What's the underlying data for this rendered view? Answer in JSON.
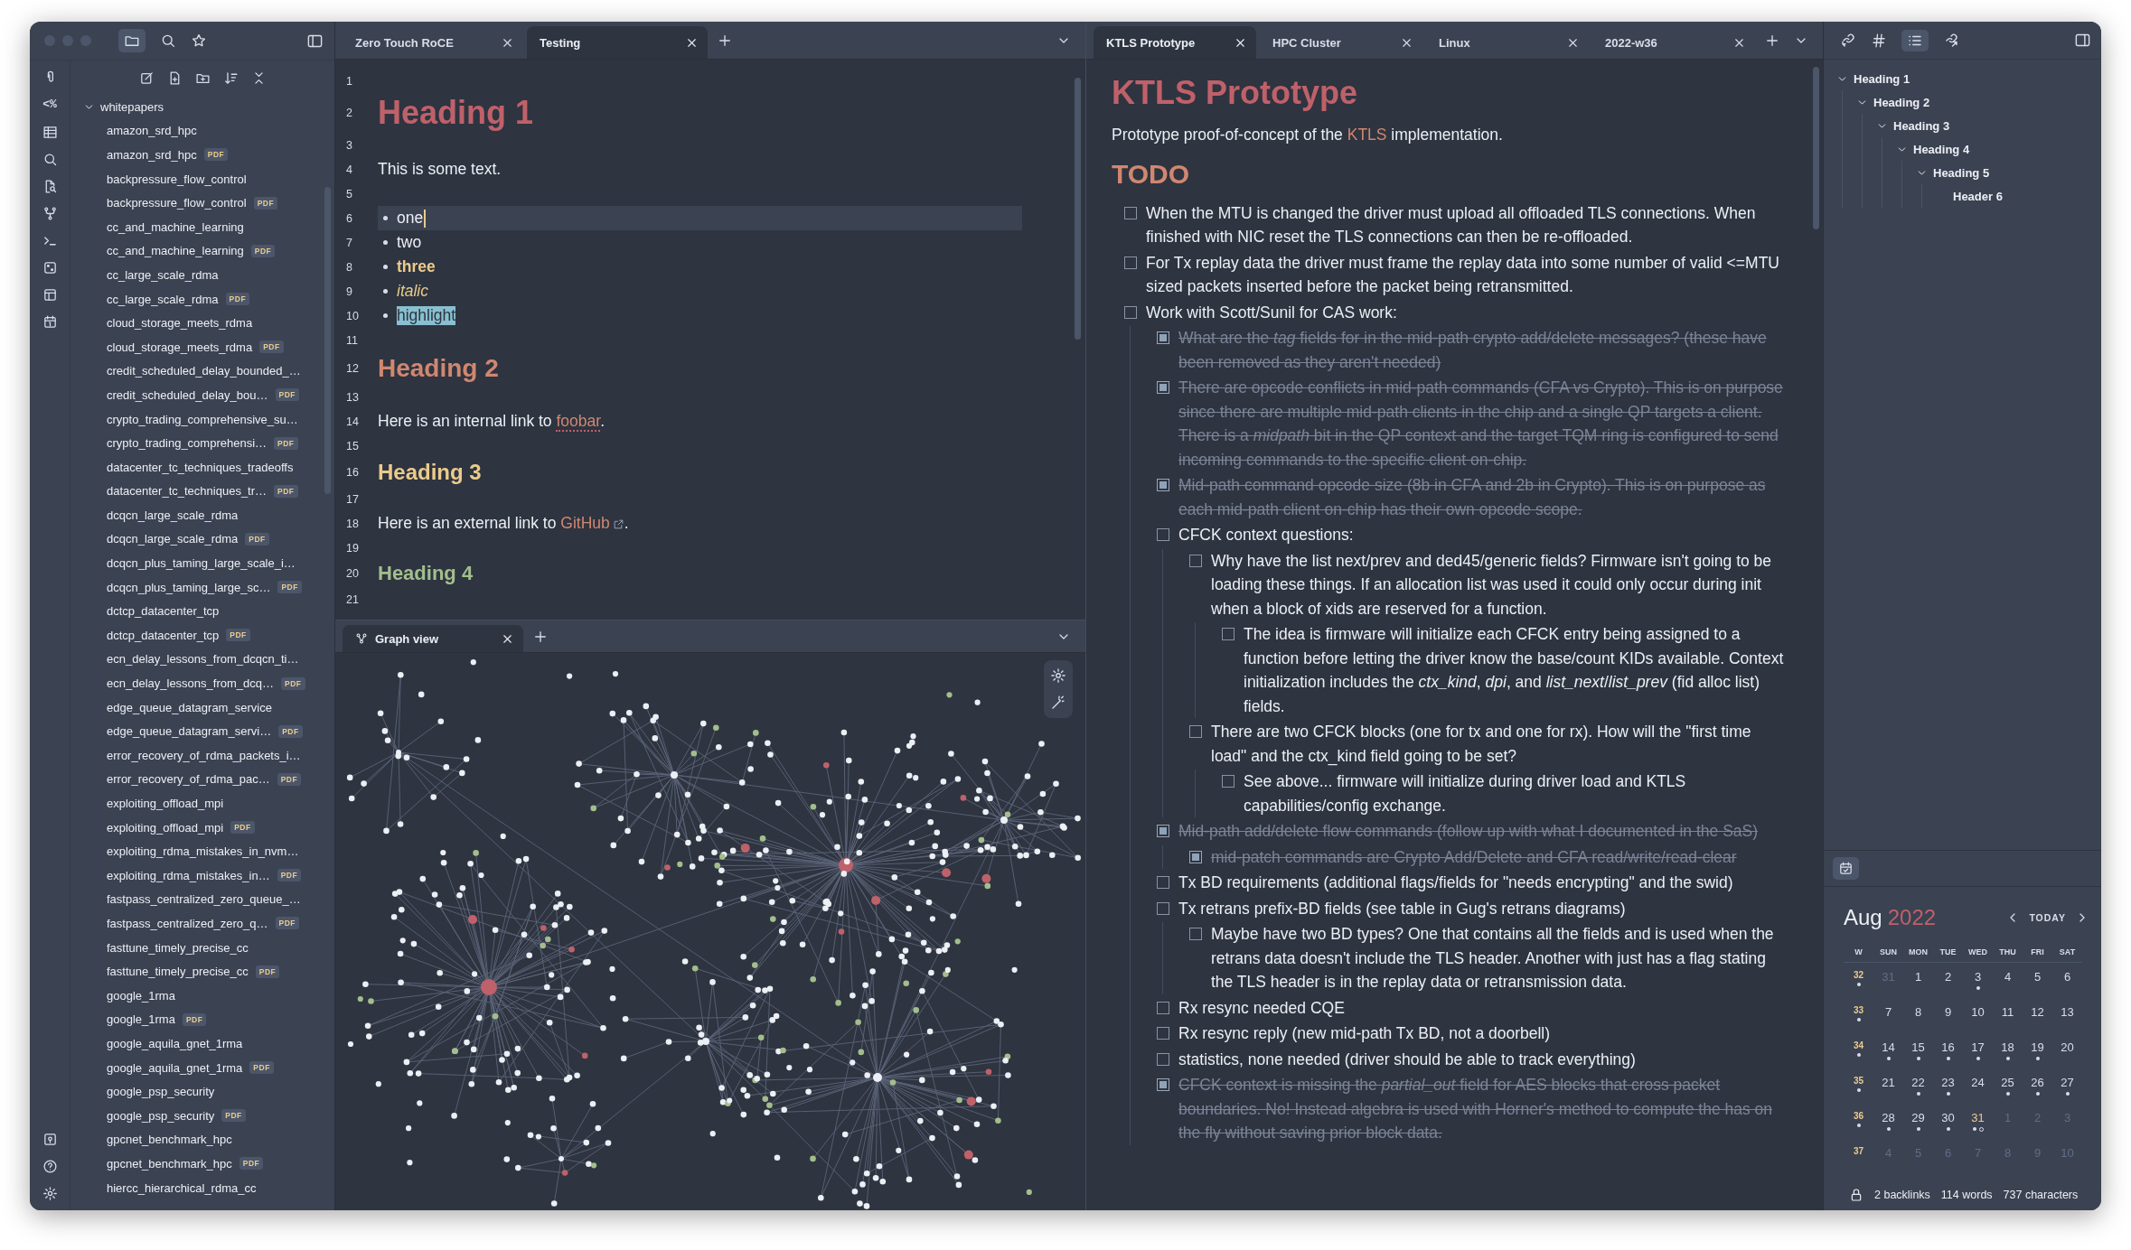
{
  "ribbon": {
    "template_glyph": "<%"
  },
  "explorer": {
    "folder": {
      "name": "whitepapers",
      "expanded": true,
      "children": [
        {
          "name": "amazon_srd_hpc"
        },
        {
          "name": "amazon_srd_hpc",
          "badge": "PDF"
        },
        {
          "name": "backpressure_flow_control"
        },
        {
          "name": "backpressure_flow_control",
          "badge": "PDF"
        },
        {
          "name": "cc_and_machine_learning"
        },
        {
          "name": "cc_and_machine_learning",
          "badge": "PDF"
        },
        {
          "name": "cc_large_scale_rdma"
        },
        {
          "name": "cc_large_scale_rdma",
          "badge": "PDF"
        },
        {
          "name": "cloud_storage_meets_rdma"
        },
        {
          "name": "cloud_storage_meets_rdma",
          "badge": "PDF"
        },
        {
          "name": "credit_scheduled_delay_bounded_…"
        },
        {
          "name": "credit_scheduled_delay_bou…",
          "badge": "PDF"
        },
        {
          "name": "crypto_trading_comprehensive_su…"
        },
        {
          "name": "crypto_trading_comprehensi…",
          "badge": "PDF"
        },
        {
          "name": "datacenter_tc_techniques_tradeoffs"
        },
        {
          "name": "datacenter_tc_techniques_tr…",
          "badge": "PDF"
        },
        {
          "name": "dcqcn_large_scale_rdma"
        },
        {
          "name": "dcqcn_large_scale_rdma",
          "badge": "PDF"
        },
        {
          "name": "dcqcn_plus_taming_large_scale_i…"
        },
        {
          "name": "dcqcn_plus_taming_large_sc…",
          "badge": "PDF"
        },
        {
          "name": "dctcp_datacenter_tcp"
        },
        {
          "name": "dctcp_datacenter_tcp",
          "badge": "PDF"
        },
        {
          "name": "ecn_delay_lessons_from_dcqcn_ti…"
        },
        {
          "name": "ecn_delay_lessons_from_dcq…",
          "badge": "PDF"
        },
        {
          "name": "edge_queue_datagram_service"
        },
        {
          "name": "edge_queue_datagram_servi…",
          "badge": "PDF"
        },
        {
          "name": "error_recovery_of_rdma_packets_i…"
        },
        {
          "name": "error_recovery_of_rdma_pac…",
          "badge": "PDF"
        },
        {
          "name": "exploiting_offload_mpi"
        },
        {
          "name": "exploiting_offload_mpi",
          "badge": "PDF"
        },
        {
          "name": "exploiting_rdma_mistakes_in_nvm…"
        },
        {
          "name": "exploiting_rdma_mistakes_in…",
          "badge": "PDF"
        },
        {
          "name": "fastpass_centralized_zero_queue_…"
        },
        {
          "name": "fastpass_centralized_zero_q…",
          "badge": "PDF"
        },
        {
          "name": "fasttune_timely_precise_cc"
        },
        {
          "name": "fasttune_timely_precise_cc",
          "badge": "PDF"
        },
        {
          "name": "google_1rma"
        },
        {
          "name": "google_1rma",
          "badge": "PDF"
        },
        {
          "name": "google_aquila_gnet_1rma"
        },
        {
          "name": "google_aquila_gnet_1rma",
          "badge": "PDF"
        },
        {
          "name": "google_psp_security"
        },
        {
          "name": "google_psp_security",
          "badge": "PDF"
        },
        {
          "name": "gpcnet_benchmark_hpc"
        },
        {
          "name": "gpcnet_benchmark_hpc",
          "badge": "PDF"
        },
        {
          "name": "hiercc_hierarchical_rdma_cc"
        }
      ]
    }
  },
  "left_pane": {
    "tabs": [
      {
        "label": "Zero Touch RoCE",
        "selected": false
      },
      {
        "label": "Testing",
        "selected": true
      }
    ],
    "lines": [
      {
        "number": "1",
        "kind": "blank",
        "active": false
      },
      {
        "number": "2",
        "kind": "h1",
        "text": "Heading 1",
        "active": false
      },
      {
        "number": "3",
        "kind": "blank",
        "active": false
      },
      {
        "number": "4",
        "kind": "text",
        "text": "This is some text.",
        "active": false
      },
      {
        "number": "5",
        "kind": "blank",
        "active": false
      },
      {
        "number": "6",
        "kind": "bullet",
        "text": "one",
        "active": true
      },
      {
        "number": "7",
        "kind": "bullet",
        "text": "two",
        "active": false
      },
      {
        "number": "8",
        "kind": "bold_bullet",
        "text": "three",
        "active": false
      },
      {
        "number": "9",
        "kind": "italic_bullet",
        "text": "italic",
        "active": false
      },
      {
        "number": "10",
        "kind": "highlight_bullet",
        "text": "highlight",
        "active": false
      },
      {
        "number": "11",
        "kind": "blank",
        "active": false
      },
      {
        "number": "12",
        "kind": "h2",
        "text": "Heading 2",
        "active": false
      },
      {
        "number": "13",
        "kind": "blank",
        "active": false
      },
      {
        "number": "14",
        "kind": "internal_link_text",
        "text": "Here is an internal link to ",
        "link": "foobar",
        "after": ".",
        "active": false
      },
      {
        "number": "15",
        "kind": "blank",
        "active": false
      },
      {
        "number": "16",
        "kind": "h3",
        "text": "Heading 3",
        "active": false
      },
      {
        "number": "17",
        "kind": "blank",
        "active": false
      },
      {
        "number": "18",
        "kind": "external_link_text",
        "text": "Here is an external link to ",
        "link": "GitHub",
        "after": ".",
        "active": false
      },
      {
        "number": "19",
        "kind": "blank",
        "active": false
      },
      {
        "number": "20",
        "kind": "h4",
        "text": "Heading 4",
        "active": false
      },
      {
        "number": "21",
        "kind": "blank",
        "active": false
      }
    ]
  },
  "graph_pane": {
    "tabs": [
      {
        "label": "Graph view",
        "selected": true
      }
    ]
  },
  "right_pane": {
    "tabs": [
      {
        "label": "KTLS Prototype",
        "selected": true
      },
      {
        "label": "HPC Cluster",
        "selected": false
      },
      {
        "label": "Linux",
        "selected": false
      },
      {
        "label": "2022-w36",
        "selected": false
      }
    ],
    "title": "KTLS Prototype",
    "intro": {
      "before": "Prototype proof-of-concept of the ",
      "link": "KTLS",
      "after": " implementation."
    },
    "heading": "TODO",
    "tasks": [
      {
        "text": "When the MTU is changed the driver must upload all offloaded TLS connections. When finished with NIC reset the TLS connections can then be re-offloaded.",
        "checked": false
      },
      {
        "text": "For Tx replay data the driver must frame the replay data into some number of valid <=MTU sized packets inserted before the packet being retransmitted.",
        "checked": false
      },
      {
        "text": "Work with Scott/Sunil for CAS work:",
        "checked": false,
        "children": [
          {
            "text": "What are the *tag* fields for in the mid-path crypto add/delete messages? (these have been removed as they aren't needed)",
            "checked": true
          },
          {
            "text": "There are opcode conflicts in mid-path commands (CFA vs Crypto). This is on purpose since there are multiple mid-path clients in the chip and a single QP targets a client. There is a *midpath* bit in the QP context and the target TQM ring is configured to send incoming commands to the specific client on-chip.",
            "checked": true
          },
          {
            "text": "Mid-path command opcode size (8b in CFA and 2b in Crypto). This is on purpose as each mid-path client on-chip has their own opcode scope.",
            "checked": true
          },
          {
            "text": "CFCK context questions:",
            "checked": false,
            "children": [
              {
                "text": "Why have the list next/prev and ded45/generic fields? Firmware isn't going to be loading these things. If an allocation list was used it could only occur during init when a block of xids are reserved for a function.",
                "checked": false,
                "children": [
                  {
                    "text": "The idea is firmware will initialize each CFCK entry being assigned to a function before letting the driver know the base/count KIDs available. Context initialization includes the *ctx_kind*, *dpi*, and *list_next*/*list_prev* (fid alloc list) fields.",
                    "checked": false
                  }
                ]
              },
              {
                "text": "There are two CFCK blocks (one for tx and one for rx). How will the \"first time load\" and the ctx_kind field going to be set?",
                "checked": false,
                "children": [
                  {
                    "text": "See above... firmware will initialize during driver load and KTLS capabilities/config exchange.",
                    "checked": false
                  }
                ]
              }
            ]
          },
          {
            "text": "Mid-path add/delete flow commands (follow up with what I documented in the SaS)",
            "checked": true,
            "children": [
              {
                "text": "mid-patch commands are Crypto Add/Delete and CFA read/write/read-clear",
                "checked": true
              }
            ]
          },
          {
            "text": "Tx BD requirements (additional flags/fields for \"needs encrypting\" and the swid)",
            "checked": false
          },
          {
            "text": "Tx retrans prefix-BD fields (see table in Gug's retrans diagrams)",
            "checked": false,
            "children": [
              {
                "text": "Maybe have two BD types? One that contains all the fields and is used when the retrans data doesn't include the TLS header. Another with just has a flag stating the TLS header is in the replay data or retransmission data.",
                "checked": false
              }
            ]
          },
          {
            "text": "Rx resync needed CQE",
            "checked": false
          },
          {
            "text": "Rx resync reply (new mid-path Tx BD, not a doorbell)",
            "checked": false
          },
          {
            "text": "statistics, none needed (driver should be able to track everything)",
            "checked": false
          },
          {
            "text": "CFCK context is missing the *partial_out* field for AES blocks that cross packet boundaries. No! Instead algebra is used with Horner's method to compute the has on the fly without saving prior block data.",
            "checked": true
          }
        ]
      }
    ]
  },
  "outline": [
    {
      "label": "Heading 1",
      "expanded": true,
      "children": [
        {
          "label": "Heading 2",
          "expanded": true,
          "children": [
            {
              "label": "Heading 3",
              "expanded": true,
              "children": [
                {
                  "label": "Heading 4",
                  "expanded": true,
                  "children": [
                    {
                      "label": "Heading 5",
                      "expanded": true,
                      "children": [
                        {
                          "label": "Header 6"
                        }
                      ]
                    }
                  ]
                }
              ]
            }
          ]
        }
      ]
    }
  ],
  "calendar": {
    "month": "Aug",
    "year": "2022",
    "today_button": "TODAY",
    "weekdays": [
      "W",
      "SUN",
      "MON",
      "TUE",
      "WED",
      "THU",
      "FRI",
      "SAT"
    ],
    "weeks": [
      {
        "week": "32",
        "dot": true,
        "days": [
          {
            "day": "31",
            "outside": true,
            "today": false,
            "dot": false,
            "task_dot": false
          },
          {
            "day": "1",
            "outside": false,
            "today": false,
            "dot": false,
            "task_dot": false
          },
          {
            "day": "2",
            "outside": false,
            "today": false,
            "dot": false,
            "task_dot": false
          },
          {
            "day": "3",
            "outside": false,
            "today": false,
            "dot": true,
            "task_dot": false
          },
          {
            "day": "4",
            "outside": false,
            "today": false,
            "dot": false,
            "task_dot": false
          },
          {
            "day": "5",
            "outside": false,
            "today": false,
            "dot": false,
            "task_dot": false
          },
          {
            "day": "6",
            "outside": false,
            "today": false,
            "dot": false,
            "task_dot": false
          }
        ]
      },
      {
        "week": "33",
        "dot": true,
        "days": [
          {
            "day": "7",
            "outside": false,
            "today": false,
            "dot": false,
            "task_dot": false
          },
          {
            "day": "8",
            "outside": false,
            "today": false,
            "dot": false,
            "task_dot": false
          },
          {
            "day": "9",
            "outside": false,
            "today": false,
            "dot": false,
            "task_dot": false
          },
          {
            "day": "10",
            "outside": false,
            "today": false,
            "dot": false,
            "task_dot": false
          },
          {
            "day": "11",
            "outside": false,
            "today": false,
            "dot": false,
            "task_dot": false
          },
          {
            "day": "12",
            "outside": false,
            "today": false,
            "dot": false,
            "task_dot": false
          },
          {
            "day": "13",
            "outside": false,
            "today": false,
            "dot": false,
            "task_dot": false
          }
        ]
      },
      {
        "week": "34",
        "dot": true,
        "days": [
          {
            "day": "14",
            "outside": false,
            "today": false,
            "dot": true,
            "task_dot": false
          },
          {
            "day": "15",
            "outside": false,
            "today": false,
            "dot": true,
            "task_dot": false
          },
          {
            "day": "16",
            "outside": false,
            "today": false,
            "dot": true,
            "task_dot": false
          },
          {
            "day": "17",
            "outside": false,
            "today": false,
            "dot": true,
            "task_dot": false
          },
          {
            "day": "18",
            "outside": false,
            "today": false,
            "dot": true,
            "task_dot": false
          },
          {
            "day": "19",
            "outside": false,
            "today": false,
            "dot": true,
            "task_dot": false
          },
          {
            "day": "20",
            "outside": false,
            "today": false,
            "dot": false,
            "task_dot": false
          }
        ]
      },
      {
        "week": "35",
        "dot": true,
        "days": [
          {
            "day": "21",
            "outside": false,
            "today": false,
            "dot": false,
            "task_dot": false
          },
          {
            "day": "22",
            "outside": false,
            "today": false,
            "dot": true,
            "task_dot": false
          },
          {
            "day": "23",
            "outside": false,
            "today": false,
            "dot": true,
            "task_dot": false
          },
          {
            "day": "24",
            "outside": false,
            "today": false,
            "dot": false,
            "task_dot": false
          },
          {
            "day": "25",
            "outside": false,
            "today": false,
            "dot": true,
            "task_dot": false
          },
          {
            "day": "26",
            "outside": false,
            "today": false,
            "dot": true,
            "task_dot": false
          },
          {
            "day": "27",
            "outside": false,
            "today": false,
            "dot": true,
            "task_dot": false
          }
        ]
      },
      {
        "week": "36",
        "dot": true,
        "days": [
          {
            "day": "28",
            "outside": false,
            "today": false,
            "dot": true,
            "task_dot": false
          },
          {
            "day": "29",
            "outside": false,
            "today": false,
            "dot": true,
            "task_dot": false
          },
          {
            "day": "30",
            "outside": false,
            "today": false,
            "dot": true,
            "task_dot": false
          },
          {
            "day": "31",
            "outside": false,
            "today": true,
            "dot": true,
            "task_dot": true
          },
          {
            "day": "1",
            "outside": true,
            "today": false,
            "dot": false,
            "task_dot": false
          },
          {
            "day": "2",
            "outside": true,
            "today": false,
            "dot": false,
            "task_dot": false
          },
          {
            "day": "3",
            "outside": true,
            "today": false,
            "dot": false,
            "task_dot": false
          }
        ]
      },
      {
        "week": "37",
        "dot": false,
        "days": [
          {
            "day": "4",
            "outside": true,
            "today": false,
            "dot": false,
            "task_dot": false
          },
          {
            "day": "5",
            "outside": true,
            "today": false,
            "dot": false,
            "task_dot": false
          },
          {
            "day": "6",
            "outside": true,
            "today": false,
            "dot": false,
            "task_dot": false
          },
          {
            "day": "7",
            "outside": true,
            "today": false,
            "dot": false,
            "task_dot": false
          },
          {
            "day": "8",
            "outside": true,
            "today": false,
            "dot": false,
            "task_dot": false
          },
          {
            "day": "9",
            "outside": true,
            "today": false,
            "dot": false,
            "task_dot": false
          },
          {
            "day": "10",
            "outside": true,
            "today": false,
            "dot": false,
            "task_dot": false
          }
        ]
      }
    ]
  },
  "status_bar": {
    "backlinks": "2 backlinks",
    "words": "114 words",
    "characters": "737 characters"
  }
}
